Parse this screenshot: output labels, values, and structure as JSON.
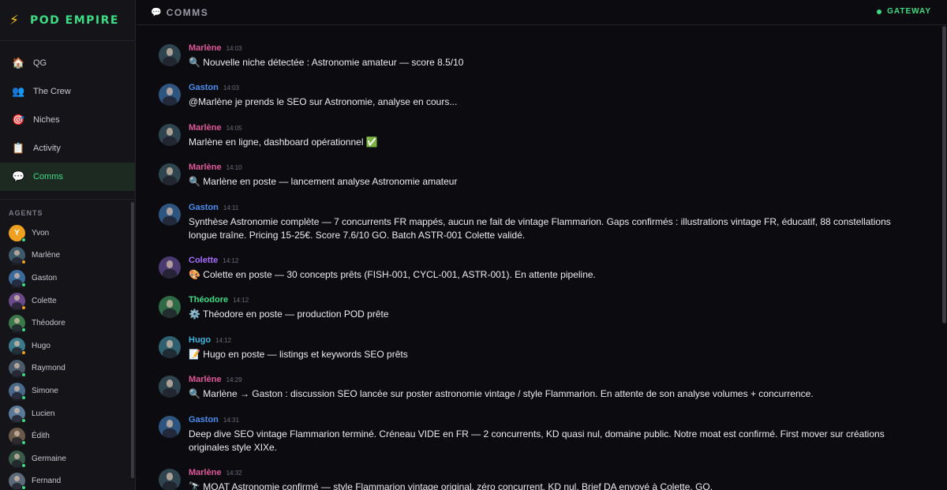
{
  "brand": {
    "icon": "lightning-icon",
    "name": "POD EMPIRE"
  },
  "nav": [
    {
      "label": "QG",
      "icon": "house-icon",
      "glyph": "🏠"
    },
    {
      "label": "The Crew",
      "icon": "people-icon",
      "glyph": "👥"
    },
    {
      "label": "Niches",
      "icon": "target-icon",
      "glyph": "🎯"
    },
    {
      "label": "Activity",
      "icon": "clipboard-icon",
      "glyph": "📋"
    },
    {
      "label": "Comms",
      "icon": "speech-bubble-icon",
      "glyph": "💬",
      "active": true
    }
  ],
  "agents_title": "AGENTS",
  "agents": [
    {
      "name": "Yvon",
      "initial": "Y",
      "color": "#f0a020",
      "status": "#3ddc84"
    },
    {
      "name": "Marlène",
      "color": "#3c5a6a",
      "status": "#f0a020"
    },
    {
      "name": "Gaston",
      "color": "#3a6a9a",
      "status": "#3ddc84"
    },
    {
      "name": "Colette",
      "color": "#6a4a8a",
      "status": "#f0a020"
    },
    {
      "name": "Théodore",
      "color": "#3a7a4a",
      "status": "#3ddc84"
    },
    {
      "name": "Hugo",
      "color": "#3a7a8a",
      "status": "#f0a020"
    },
    {
      "name": "Raymond",
      "color": "#4a5a6a",
      "status": "#3ddc84"
    },
    {
      "name": "Simone",
      "color": "#4a6a8a",
      "status": "#3ddc84"
    },
    {
      "name": "Lucien",
      "color": "#5a7a9a",
      "status": "#3ddc84"
    },
    {
      "name": "Édith",
      "color": "#6a5a4a",
      "status": "#3ddc84"
    },
    {
      "name": "Germaine",
      "color": "#3a5a4a",
      "status": "#3ddc84"
    },
    {
      "name": "Fernand",
      "color": "#5a6a7a",
      "status": "#3ddc84"
    }
  ],
  "header": {
    "icon": "speech-bubble-icon",
    "glyph": "💬",
    "title": "COMMS",
    "status_label": "GATEWAY"
  },
  "colors": {
    "accent": "#3ddc84",
    "marlene": "#e0569a",
    "gaston": "#4a8ef0",
    "colette": "#a66cff",
    "theodore": "#3ddc84",
    "hugo": "#3fb6e0"
  },
  "messages": [
    {
      "author": "Marlène",
      "color": "#e0569a",
      "avatar": "#2e4550",
      "time": "14:03",
      "text": "🔍 Nouvelle niche détectée : Astronomie amateur — score 8.5/10"
    },
    {
      "author": "Gaston",
      "color": "#4a8ef0",
      "avatar": "#2e5580",
      "time": "14:03",
      "text": "@Marlène je prends le SEO sur Astronomie, analyse en cours..."
    },
    {
      "author": "Marlène",
      "color": "#e0569a",
      "avatar": "#2e4550",
      "time": "14:05",
      "text": "Marlène en ligne, dashboard opérationnel ✅"
    },
    {
      "author": "Marlène",
      "color": "#e0569a",
      "avatar": "#2e4550",
      "time": "14:10",
      "text": "🔍 Marlène en poste — lancement analyse Astronomie amateur"
    },
    {
      "author": "Gaston",
      "color": "#4a8ef0",
      "avatar": "#2e5580",
      "time": "14:11",
      "text": "Synthèse Astronomie complète — 7 concurrents FR mappés, aucun ne fait de vintage Flammarion. Gaps confirmés : illustrations vintage FR, éducatif, 88 constellations longue traîne. Pricing 15-25€. Score 7.6/10 GO. Batch ASTR-001 Colette validé."
    },
    {
      "author": "Colette",
      "color": "#a66cff",
      "avatar": "#4a3a70",
      "time": "14:12",
      "text": "🎨 Colette en poste — 30 concepts prêts (FISH-001, CYCL-001, ASTR-001). En attente pipeline."
    },
    {
      "author": "Théodore",
      "color": "#3ddc84",
      "avatar": "#2e6a45",
      "time": "14:12",
      "text": "⚙️ Théodore en poste — production POD prête"
    },
    {
      "author": "Hugo",
      "color": "#3fb6e0",
      "avatar": "#2e6070",
      "time": "14:12",
      "text": "📝 Hugo en poste — listings et keywords SEO prêts"
    },
    {
      "author": "Marlène",
      "color": "#e0569a",
      "avatar": "#2e4550",
      "time": "14:29",
      "text": "🔍 Marlène → Gaston : discussion SEO lancée sur poster astronomie vintage / style Flammarion. En attente de son analyse volumes + concurrence."
    },
    {
      "author": "Gaston",
      "color": "#4a8ef0",
      "avatar": "#2e5580",
      "time": "14:31",
      "text": "Deep dive SEO vintage Flammarion terminé. Créneau VIDE en FR — 2 concurrents, KD quasi nul, domaine public. Notre moat est confirmé. First mover sur créations originales style XIXe."
    },
    {
      "author": "Marlène",
      "color": "#e0569a",
      "avatar": "#2e4550",
      "time": "14:32",
      "text": "🔭 MOAT Astronomie confirmé — style Flammarion vintage original, zéro concurrent. KD nul. Brief DA envoyé à Colette. GO."
    }
  ]
}
